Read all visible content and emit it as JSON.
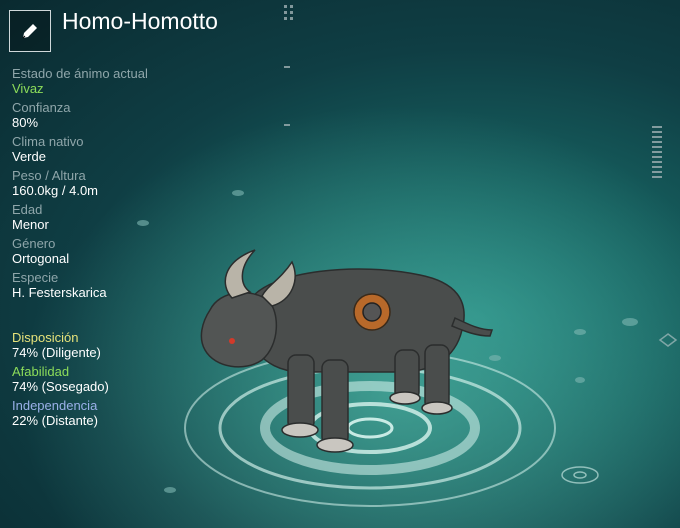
{
  "creature": {
    "name": "Homo-Homotto",
    "edit_icon": "pencil-icon"
  },
  "stats": [
    {
      "label": "Estado de ánimo actual",
      "value": "Vivaz",
      "key": "mood"
    },
    {
      "label": "Confianza",
      "value": "80%",
      "key": "trust"
    },
    {
      "label": "Clima nativo",
      "value": "Verde",
      "key": "climate"
    },
    {
      "label": "Peso / Altura",
      "value": "160.0kg / 4.0m",
      "key": "size"
    },
    {
      "label": "Edad",
      "value": "Menor",
      "key": "age"
    },
    {
      "label": "Género",
      "value": "Ortogonal",
      "key": "gender"
    },
    {
      "label": "Especie",
      "value": "H. Festerskarica",
      "key": "species"
    }
  ],
  "traits": [
    {
      "label": "Disposición",
      "value": "74% (Diligente)",
      "color": "#e6e27a"
    },
    {
      "label": "Afabilidad",
      "value": "74% (Sosegado)",
      "color": "#8cdc5a"
    },
    {
      "label": "Independencia",
      "value": "22% (Distante)",
      "color": "#9ab0e8"
    }
  ],
  "colors": {
    "mood_value": "#8cdc5a",
    "label": "#8fa6aa"
  }
}
